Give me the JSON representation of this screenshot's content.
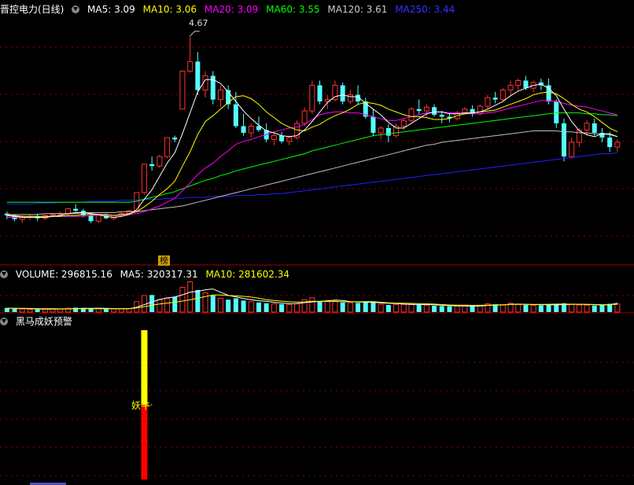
{
  "main_header": {
    "title": "晋控电力(日线)",
    "ma5": "MA5: 3.09",
    "ma10": "MA10: 3.06",
    "ma20": "MA20: 3.09",
    "ma60": "MA60: 3.55",
    "ma120": "MA120: 3.61",
    "ma250": "MA250: 3.44"
  },
  "volume_header": {
    "volume": "VOLUME: 296815.16",
    "ma5": "MA5: 320317.31",
    "ma10": "MA10: 281602.34"
  },
  "signal_panel": {
    "title": "黑马成妖预警",
    "signal_label": "妖牛"
  },
  "peak_annotation": "4.67",
  "badge_text": "榜",
  "colors": {
    "up": "#ff3232",
    "down": "#54ffff",
    "ma5": "#ffffff",
    "ma10": "#ffff00",
    "ma20": "#ff00ff",
    "ma60": "#00ff00",
    "ma120": "#c0c0c0",
    "ma250": "#2020ff",
    "grid": "#8b0000"
  },
  "chart_data": {
    "type": "candlestick",
    "price_ylim": [
      2.4,
      4.8
    ],
    "ohlc": [
      [
        2.8,
        2.82,
        2.74,
        2.78
      ],
      [
        2.78,
        2.79,
        2.72,
        2.74
      ],
      [
        2.74,
        2.78,
        2.7,
        2.76
      ],
      [
        2.76,
        2.79,
        2.73,
        2.77
      ],
      [
        2.77,
        2.8,
        2.72,
        2.75
      ],
      [
        2.75,
        2.79,
        2.73,
        2.78
      ],
      [
        2.78,
        2.8,
        2.76,
        2.79
      ],
      [
        2.79,
        2.82,
        2.77,
        2.8
      ],
      [
        2.8,
        2.86,
        2.78,
        2.85
      ],
      [
        2.85,
        2.9,
        2.82,
        2.83
      ],
      [
        2.83,
        2.85,
        2.76,
        2.78
      ],
      [
        2.78,
        2.81,
        2.7,
        2.72
      ],
      [
        2.72,
        2.8,
        2.7,
        2.79
      ],
      [
        2.79,
        2.8,
        2.74,
        2.75
      ],
      [
        2.75,
        2.79,
        2.73,
        2.78
      ],
      [
        2.78,
        2.82,
        2.76,
        2.8
      ],
      [
        2.8,
        2.84,
        2.79,
        2.83
      ],
      [
        2.83,
        3.02,
        2.82,
        3.02
      ],
      [
        3.02,
        3.32,
        3.0,
        3.32
      ],
      [
        3.32,
        3.4,
        3.25,
        3.3
      ],
      [
        3.3,
        3.42,
        3.28,
        3.4
      ],
      [
        3.4,
        3.6,
        3.38,
        3.6
      ],
      [
        3.6,
        3.62,
        3.55,
        3.58
      ],
      [
        3.9,
        4.3,
        3.9,
        4.3
      ],
      [
        4.3,
        4.67,
        4.28,
        4.4
      ],
      [
        4.4,
        4.5,
        4.05,
        4.1
      ],
      [
        4.1,
        4.3,
        4.02,
        4.25
      ],
      [
        4.25,
        4.3,
        3.95,
        4.0
      ],
      [
        4.0,
        4.15,
        3.92,
        4.1
      ],
      [
        4.1,
        4.15,
        3.9,
        3.95
      ],
      [
        3.95,
        4.08,
        3.7,
        3.72
      ],
      [
        3.72,
        3.85,
        3.62,
        3.65
      ],
      [
        3.65,
        3.75,
        3.6,
        3.72
      ],
      [
        3.72,
        3.82,
        3.66,
        3.68
      ],
      [
        3.68,
        3.75,
        3.55,
        3.58
      ],
      [
        3.58,
        3.65,
        3.52,
        3.62
      ],
      [
        3.62,
        3.66,
        3.54,
        3.56
      ],
      [
        3.56,
        3.62,
        3.52,
        3.6
      ],
      [
        3.6,
        3.78,
        3.58,
        3.75
      ],
      [
        3.75,
        3.92,
        3.72,
        3.88
      ],
      [
        3.88,
        4.2,
        3.85,
        4.15
      ],
      [
        4.15,
        4.2,
        3.95,
        3.98
      ],
      [
        3.98,
        4.05,
        3.9,
        4.0
      ],
      [
        4.0,
        4.2,
        3.98,
        4.15
      ],
      [
        4.15,
        4.18,
        3.95,
        3.98
      ],
      [
        3.98,
        4.1,
        3.95,
        4.05
      ],
      [
        4.05,
        4.15,
        3.95,
        3.98
      ],
      [
        3.98,
        4.02,
        3.8,
        3.82
      ],
      [
        3.82,
        3.9,
        3.62,
        3.65
      ],
      [
        3.65,
        3.72,
        3.58,
        3.7
      ],
      [
        3.7,
        3.74,
        3.55,
        3.62
      ],
      [
        3.62,
        3.75,
        3.6,
        3.72
      ],
      [
        3.72,
        3.8,
        3.68,
        3.78
      ],
      [
        3.78,
        3.92,
        3.76,
        3.9
      ],
      [
        3.9,
        4.0,
        3.85,
        3.88
      ],
      [
        3.88,
        3.95,
        3.82,
        3.92
      ],
      [
        3.92,
        3.95,
        3.82,
        3.84
      ],
      [
        3.84,
        3.88,
        3.75,
        3.82
      ],
      [
        3.82,
        3.86,
        3.76,
        3.8
      ],
      [
        3.8,
        3.88,
        3.78,
        3.86
      ],
      [
        3.86,
        3.92,
        3.84,
        3.9
      ],
      [
        3.9,
        3.94,
        3.82,
        3.85
      ],
      [
        3.85,
        3.95,
        3.83,
        3.93
      ],
      [
        3.93,
        4.05,
        3.9,
        4.02
      ],
      [
        4.02,
        4.08,
        3.96,
        4.0
      ],
      [
        4.0,
        4.12,
        3.98,
        4.1
      ],
      [
        4.1,
        4.2,
        4.05,
        4.15
      ],
      [
        4.15,
        4.22,
        4.1,
        4.2
      ],
      [
        4.2,
        4.25,
        4.1,
        4.12
      ],
      [
        4.12,
        4.2,
        4.08,
        4.18
      ],
      [
        4.18,
        4.22,
        4.1,
        4.15
      ],
      [
        4.15,
        4.22,
        3.95,
        3.98
      ],
      [
        3.98,
        4.0,
        3.7,
        3.75
      ],
      [
        3.75,
        3.8,
        3.35,
        3.4
      ],
      [
        3.4,
        3.6,
        3.38,
        3.55
      ],
      [
        3.55,
        3.7,
        3.5,
        3.68
      ],
      [
        3.68,
        3.78,
        3.62,
        3.75
      ],
      [
        3.75,
        3.8,
        3.62,
        3.65
      ],
      [
        3.65,
        3.7,
        3.55,
        3.6
      ],
      [
        3.6,
        3.66,
        3.45,
        3.5
      ],
      [
        3.5,
        3.58,
        3.45,
        3.55
      ]
    ],
    "ma5_values": [
      2.78,
      2.77,
      2.76,
      2.76,
      2.76,
      2.76,
      2.77,
      2.78,
      2.8,
      2.81,
      2.81,
      2.8,
      2.79,
      2.77,
      2.76,
      2.77,
      2.79,
      2.84,
      2.95,
      3.05,
      3.19,
      3.33,
      3.44,
      3.64,
      3.86,
      4.08,
      4.21,
      4.21,
      4.17,
      4.08,
      3.98,
      3.88,
      3.8,
      3.73,
      3.67,
      3.65,
      3.62,
      3.61,
      3.62,
      3.68,
      3.77,
      3.87,
      3.97,
      4.03,
      4.05,
      4.03,
      4.03,
      3.96,
      3.9,
      3.84,
      3.76,
      3.7,
      3.7,
      3.75,
      3.8,
      3.85,
      3.87,
      3.87,
      3.85,
      3.85,
      3.86,
      3.86,
      3.87,
      3.9,
      3.94,
      3.98,
      4.04,
      4.09,
      4.12,
      4.15,
      4.16,
      4.12,
      4.04,
      3.9,
      3.77,
      3.67,
      3.63,
      3.61,
      3.64,
      3.64,
      3.61
    ],
    "ma10_values": [
      2.78,
      2.78,
      2.77,
      2.77,
      2.77,
      2.77,
      2.77,
      2.77,
      2.78,
      2.78,
      2.79,
      2.79,
      2.79,
      2.79,
      2.78,
      2.79,
      2.8,
      2.82,
      2.87,
      2.93,
      3.0,
      3.06,
      3.14,
      3.3,
      3.45,
      3.63,
      3.77,
      3.83,
      3.9,
      3.97,
      4.03,
      4.04,
      4.01,
      3.95,
      3.87,
      3.81,
      3.75,
      3.71,
      3.68,
      3.67,
      3.71,
      3.74,
      3.79,
      3.83,
      3.86,
      3.9,
      3.95,
      3.97,
      3.96,
      3.94,
      3.9,
      3.87,
      3.84,
      3.82,
      3.82,
      3.81,
      3.79,
      3.79,
      3.8,
      3.83,
      3.85,
      3.86,
      3.87,
      3.88,
      3.89,
      3.92,
      3.95,
      3.98,
      4.01,
      4.05,
      4.07,
      4.08,
      4.06,
      4.01,
      3.95,
      3.9,
      3.87,
      3.82,
      3.76,
      3.7,
      3.66
    ],
    "ma20_values": [
      2.76,
      2.76,
      2.76,
      2.76,
      2.76,
      2.76,
      2.77,
      2.77,
      2.77,
      2.77,
      2.77,
      2.78,
      2.78,
      2.78,
      2.78,
      2.78,
      2.79,
      2.8,
      2.82,
      2.85,
      2.88,
      2.92,
      2.96,
      3.04,
      3.12,
      3.21,
      3.28,
      3.33,
      3.4,
      3.46,
      3.53,
      3.56,
      3.58,
      3.61,
      3.63,
      3.66,
      3.68,
      3.7,
      3.71,
      3.74,
      3.79,
      3.84,
      3.86,
      3.87,
      3.87,
      3.86,
      3.86,
      3.84,
      3.82,
      3.8,
      3.78,
      3.78,
      3.8,
      3.82,
      3.84,
      3.86,
      3.87,
      3.87,
      3.86,
      3.86,
      3.85,
      3.85,
      3.85,
      3.86,
      3.87,
      3.89,
      3.91,
      3.93,
      3.95,
      3.97,
      3.99,
      3.99,
      3.98,
      3.96,
      3.94,
      3.93,
      3.92,
      3.9,
      3.88,
      3.86,
      3.84
    ],
    "ma60_values": [
      2.92,
      2.92,
      2.92,
      2.92,
      2.92,
      2.92,
      2.92,
      2.92,
      2.92,
      2.92,
      2.92,
      2.92,
      2.92,
      2.92,
      2.92,
      2.92,
      2.92,
      2.93,
      2.95,
      2.97,
      2.99,
      3.01,
      3.03,
      3.06,
      3.09,
      3.12,
      3.15,
      3.17,
      3.2,
      3.22,
      3.25,
      3.27,
      3.29,
      3.31,
      3.33,
      3.35,
      3.37,
      3.39,
      3.41,
      3.43,
      3.46,
      3.48,
      3.5,
      3.52,
      3.54,
      3.56,
      3.58,
      3.6,
      3.62,
      3.63,
      3.64,
      3.65,
      3.66,
      3.67,
      3.68,
      3.69,
      3.7,
      3.71,
      3.72,
      3.73,
      3.74,
      3.75,
      3.76,
      3.77,
      3.78,
      3.79,
      3.8,
      3.81,
      3.82,
      3.83,
      3.84,
      3.85,
      3.86,
      3.86,
      3.86,
      3.86,
      3.85,
      3.85,
      3.84,
      3.84,
      3.83
    ],
    "ma120_values": [
      2.79,
      2.79,
      2.79,
      2.79,
      2.79,
      2.8,
      2.8,
      2.8,
      2.8,
      2.8,
      2.81,
      2.81,
      2.81,
      2.81,
      2.81,
      2.82,
      2.82,
      2.82,
      2.83,
      2.84,
      2.85,
      2.86,
      2.87,
      2.88,
      2.9,
      2.92,
      2.94,
      2.96,
      2.98,
      3.0,
      3.02,
      3.04,
      3.06,
      3.08,
      3.1,
      3.12,
      3.14,
      3.16,
      3.18,
      3.2,
      3.22,
      3.24,
      3.26,
      3.28,
      3.3,
      3.32,
      3.34,
      3.36,
      3.38,
      3.4,
      3.42,
      3.44,
      3.46,
      3.48,
      3.5,
      3.52,
      3.53,
      3.55,
      3.56,
      3.57,
      3.58,
      3.59,
      3.6,
      3.61,
      3.62,
      3.63,
      3.64,
      3.65,
      3.66,
      3.67,
      3.67,
      3.67,
      3.67,
      3.66,
      3.66,
      3.65,
      3.65,
      3.64,
      3.64,
      3.63,
      3.61
    ],
    "ma250_values": [
      2.9,
      2.9,
      2.9,
      2.9,
      2.91,
      2.91,
      2.91,
      2.92,
      2.92,
      2.92,
      2.92,
      2.93,
      2.93,
      2.93,
      2.93,
      2.94,
      2.94,
      2.94,
      2.95,
      2.95,
      2.95,
      2.96,
      2.96,
      2.96,
      2.97,
      2.97,
      2.97,
      2.98,
      2.98,
      2.98,
      2.99,
      2.99,
      2.99,
      3.0,
      3.0,
      3.01,
      3.01,
      3.02,
      3.03,
      3.04,
      3.05,
      3.06,
      3.07,
      3.08,
      3.09,
      3.1,
      3.11,
      3.12,
      3.13,
      3.14,
      3.15,
      3.16,
      3.17,
      3.18,
      3.19,
      3.2,
      3.21,
      3.22,
      3.23,
      3.24,
      3.25,
      3.26,
      3.27,
      3.28,
      3.29,
      3.3,
      3.31,
      3.32,
      3.33,
      3.34,
      3.35,
      3.36,
      3.37,
      3.38,
      3.39,
      3.4,
      3.41,
      3.42,
      3.43,
      3.43,
      3.44
    ],
    "volume_ylim": [
      0,
      1200000
    ],
    "volume_values": [
      150000,
      120000,
      110000,
      100000,
      95000,
      105000,
      120000,
      110000,
      140000,
      160000,
      150000,
      120000,
      130000,
      110000,
      120000,
      115000,
      130000,
      380000,
      600000,
      620000,
      450000,
      500000,
      560000,
      900000,
      1100000,
      800000,
      700000,
      600000,
      500000,
      450000,
      500000,
      420000,
      380000,
      350000,
      320000,
      300000,
      290000,
      280000,
      300000,
      450000,
      520000,
      400000,
      380000,
      420000,
      350000,
      340000,
      330000,
      380000,
      360000,
      280000,
      260000,
      270000,
      280000,
      300000,
      260000,
      250000,
      230000,
      220000,
      210000,
      220000,
      230000,
      210000,
      240000,
      300000,
      280000,
      260000,
      320000,
      280000,
      260000,
      240000,
      250000,
      260000,
      280000,
      320000,
      290000,
      260000,
      250000,
      240000,
      250000,
      300000,
      296815
    ],
    "volume_ma5": [
      140000,
      135000,
      128000,
      120000,
      115000,
      106000,
      108000,
      110000,
      115000,
      127000,
      136000,
      136000,
      140000,
      134000,
      126000,
      119000,
      121000,
      173000,
      268000,
      370000,
      456000,
      514000,
      546000,
      626000,
      726000,
      752000,
      812000,
      840000,
      720000,
      610000,
      550000,
      494000,
      450000,
      410000,
      394000,
      354000,
      328000,
      308000,
      310000,
      344000,
      368000,
      390000,
      410000,
      434000,
      424000,
      378000,
      364000,
      360000,
      356000,
      332000,
      322000,
      310000,
      290000,
      274000,
      274000,
      272000,
      262000,
      248000,
      234000,
      226000,
      222000,
      218000,
      222000,
      240000,
      254000,
      258000,
      282000,
      288000,
      284000,
      272000,
      272000,
      262000,
      262000,
      270000,
      280000,
      282000,
      280000,
      272000,
      258000,
      268000,
      320317
    ],
    "volume_ma10": [
      140000,
      138000,
      134000,
      130000,
      125000,
      122000,
      120000,
      118000,
      118000,
      120000,
      122000,
      122000,
      124000,
      124000,
      124000,
      124000,
      126000,
      150000,
      194000,
      248000,
      291000,
      326000,
      358000,
      400000,
      445000,
      502000,
      565000,
      623000,
      622000,
      601000,
      589000,
      571000,
      545000,
      502000,
      452000,
      422000,
      396000,
      374000,
      362000,
      370000,
      391000,
      390000,
      388000,
      385000,
      373000,
      373000,
      375000,
      380000,
      380000,
      356000,
      336000,
      326000,
      320000,
      314000,
      307000,
      299000,
      288000,
      272000,
      258000,
      252000,
      250000,
      246000,
      246000,
      252000,
      262000,
      266000,
      274000,
      280000,
      280000,
      276000,
      277000,
      284000,
      288000,
      290000,
      287000,
      282000,
      279000,
      274000,
      270000,
      272000,
      281602
    ],
    "signal": {
      "bar_index": 18,
      "red_segment": [
        0,
        0.5
      ],
      "yellow_segment": [
        0.5,
        1.0
      ]
    }
  }
}
